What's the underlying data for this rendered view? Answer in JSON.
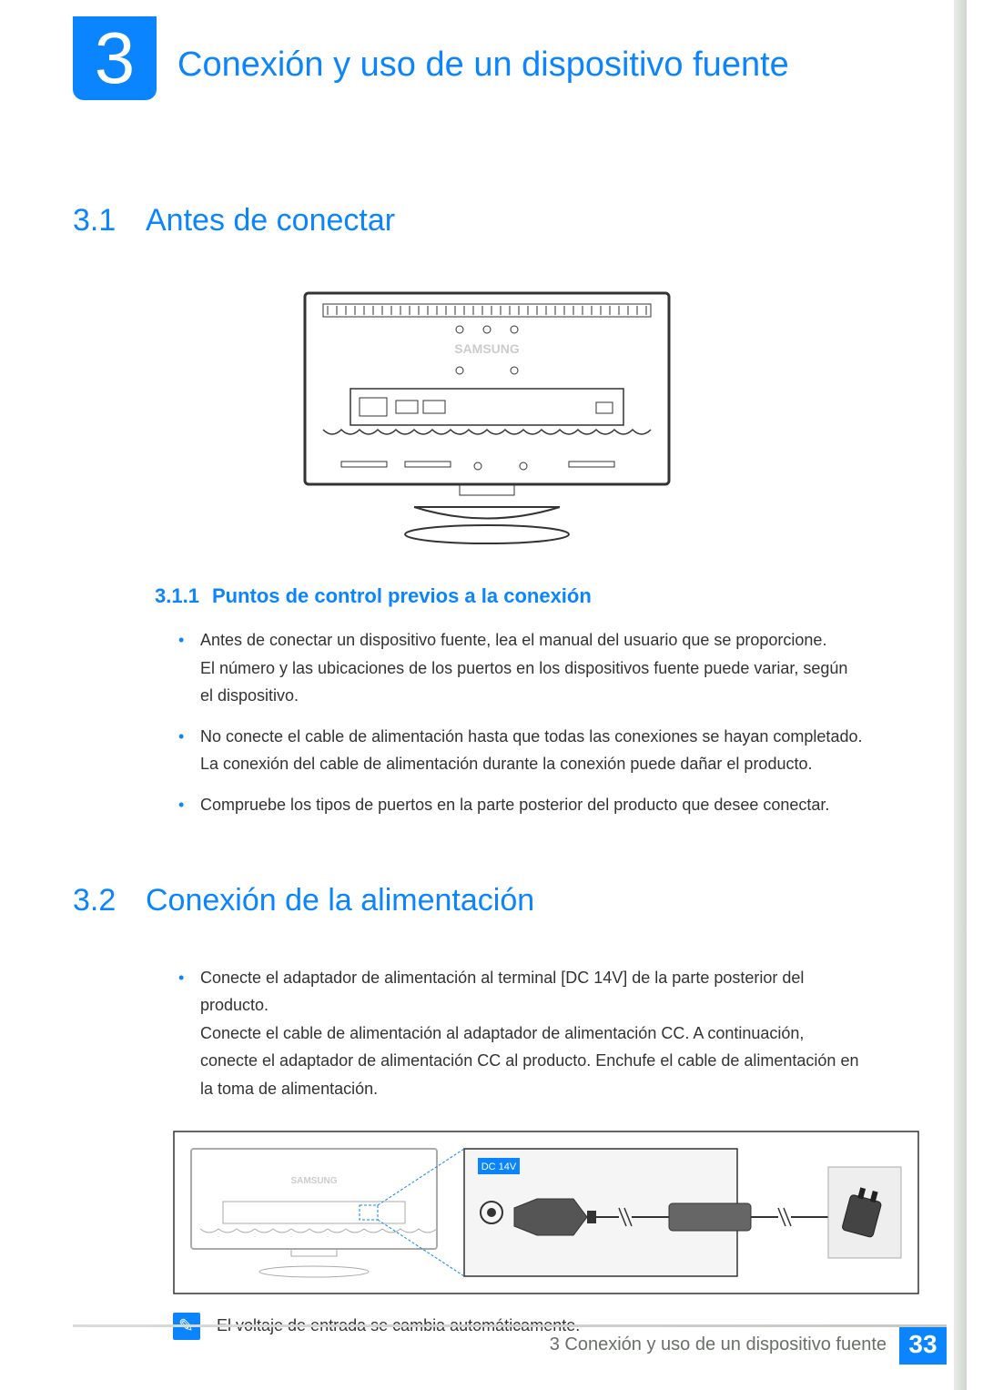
{
  "chapter": {
    "number": "3",
    "title": "Conexión y uso de un dispositivo fuente"
  },
  "section_3_1": {
    "num": "3.1",
    "title": "Antes de conectar",
    "sub_3_1_1": {
      "num": "3.1.1",
      "title": "Puntos de control previos a la conexión",
      "bullets": [
        {
          "main": "Antes de conectar un dispositivo fuente, lea el manual del usuario que se proporcione.",
          "sub": "El número y las ubicaciones de los puertos en los dispositivos fuente puede variar, según el dispositivo."
        },
        {
          "main": "No conecte el cable de alimentación hasta que todas las conexiones se hayan completado.",
          "sub": "La conexión del cable de alimentación durante la conexión puede dañar el producto."
        },
        {
          "main": "Compruebe los tipos de puertos en la parte posterior del producto que desee conectar.",
          "sub": ""
        }
      ]
    }
  },
  "section_3_2": {
    "num": "3.2",
    "title": "Conexión de la alimentación",
    "bullets": [
      {
        "main": "Conecte el adaptador de alimentación al terminal [DC 14V] de la parte posterior del producto.",
        "sub": "Conecte el cable de alimentación al adaptador de alimentación CC. A continuación, conecte el adaptador de alimentación CC al producto. Enchufe el cable de alimentación en la toma de alimentación."
      }
    ],
    "port_label": "DC 14V",
    "note": "El voltaje de entrada se cambia automáticamente."
  },
  "diagram_brand": "SAMSUNG",
  "footer": {
    "text": "3 Conexión y uso de un dispositivo fuente",
    "page": "33"
  }
}
